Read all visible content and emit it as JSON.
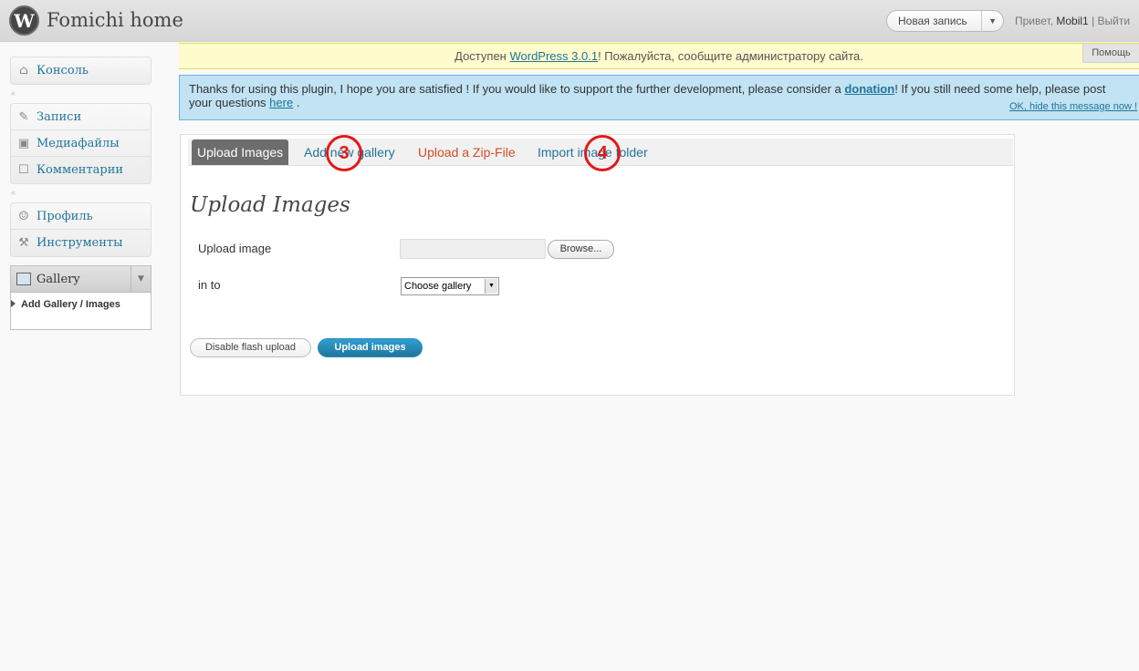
{
  "header": {
    "site_title": "Fomichi home",
    "new_post_label": "Новая запись",
    "greeting": "Привет,",
    "username": "Mobil1",
    "separator": "|",
    "logout": "Выйти"
  },
  "update_nag": {
    "prefix": "Доступен ",
    "link": "WordPress 3.0.1",
    "suffix": "! Пожалуйста, сообщите администратору сайта."
  },
  "help_tab": "Помощь",
  "notice": {
    "text_1": "Thanks for using this plugin, I hope you are satisfied ! If you would like to support the further development, please consider a ",
    "donation_link": "donation",
    "text_2": "! If you still need some help, please post your questions ",
    "here_link": "here",
    "text_3": " .",
    "hide_link": "OK, hide this message now !"
  },
  "sidebar": {
    "group1": [
      {
        "label": "Консоль",
        "icon": "dashboard-icon"
      }
    ],
    "group2": [
      {
        "label": "Записи",
        "icon": "pin-icon"
      },
      {
        "label": "Медиафайлы",
        "icon": "media-icon"
      },
      {
        "label": "Комментарии",
        "icon": "comment-icon"
      }
    ],
    "group3": [
      {
        "label": "Профиль",
        "icon": "users-icon"
      },
      {
        "label": "Инструменты",
        "icon": "tools-icon"
      }
    ],
    "gallery": {
      "label": "Gallery",
      "submenu": "Add Gallery / Images"
    }
  },
  "tabs": [
    {
      "label": "Upload Images",
      "active": true
    },
    {
      "label": "Add new gallery"
    },
    {
      "label": "Upload a Zip-File"
    },
    {
      "label": "Import image folder"
    }
  ],
  "main": {
    "title": "Upload Images",
    "upload_label": "Upload image",
    "browse_label": "Browse...",
    "into_label": "in to",
    "gallery_select": "Choose gallery",
    "disable_flash_label": "Disable flash upload",
    "upload_button_label": "Upload images"
  },
  "markers": [
    {
      "label": "3"
    },
    {
      "label": "4"
    }
  ],
  "colors": {
    "link": "#21759b",
    "accent_orange": "#d54e21",
    "marker_red": "#e01a1a",
    "nag_bg": "#fffbcc",
    "notice_bg": "#c1e3f3"
  }
}
